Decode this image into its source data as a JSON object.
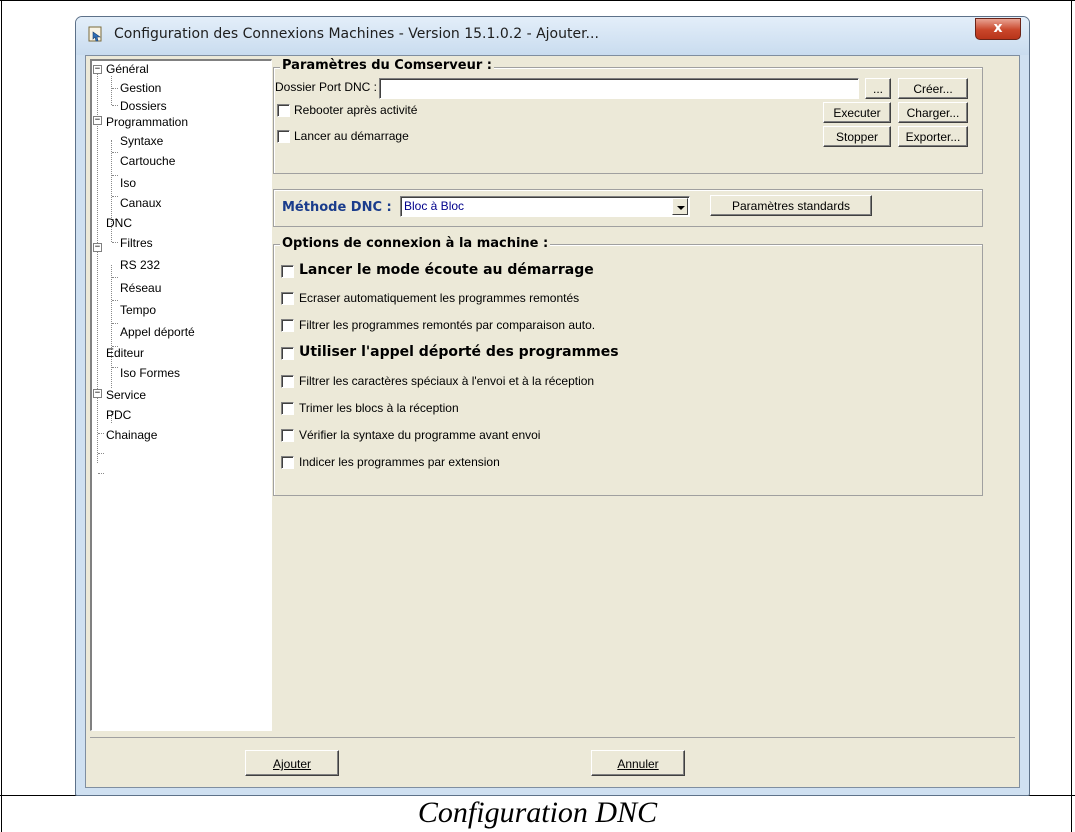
{
  "window": {
    "title": "Configuration des Connexions Machines - Version 15.1.0.2 - Ajouter...",
    "close_label": "x"
  },
  "tree": {
    "general": "Général",
    "gestion": "Gestion",
    "dossiers": "Dossiers",
    "programmation": "Programmation",
    "syntaxe": "Syntaxe",
    "cartouche": "Cartouche",
    "iso": "Iso",
    "canaux": "Canaux",
    "dnc": "DNC",
    "filtres": "Filtres",
    "rs232": "RS 232",
    "reseau": "Réseau",
    "tempo": "Tempo",
    "appel": "Appel déporté",
    "editeur": "Editeur",
    "isoformes": "Iso Formes",
    "service": "Service",
    "pdc": "PDC",
    "chainage": "Chainage",
    "expander": "−"
  },
  "comserveur": {
    "title": "Paramètres du Comserveur :",
    "dossier_label": "Dossier Port DNC :",
    "dossier_value": "",
    "browse": "...",
    "rebooter": "Rebooter après activité",
    "lancer": "Lancer au démarrage",
    "creer": "Créer...",
    "executer": "Executer",
    "charger": "Charger...",
    "stopper": "Stopper",
    "exporter": "Exporter..."
  },
  "methode": {
    "label": "Méthode DNC :",
    "value": "Bloc à Bloc",
    "standards": "Paramètres standards"
  },
  "options": {
    "title": "Options de connexion à la machine :",
    "items": [
      "Lancer le mode écoute au démarrage",
      "Ecraser automatiquement les programmes remontés",
      "Filtrer les programmes remontés par comparaison auto.",
      "Utiliser l'appel déporté des programmes",
      "Filtrer les caractères spéciaux à l'envoi et à la réception",
      "Trimer les blocs à la réception",
      "Vérifier la syntaxe du programme avant envoi",
      "Indicer les programmes par extension"
    ]
  },
  "footer": {
    "ajouter": "Ajouter",
    "annuler": "Annuler"
  },
  "caption": "Configuration DNC"
}
